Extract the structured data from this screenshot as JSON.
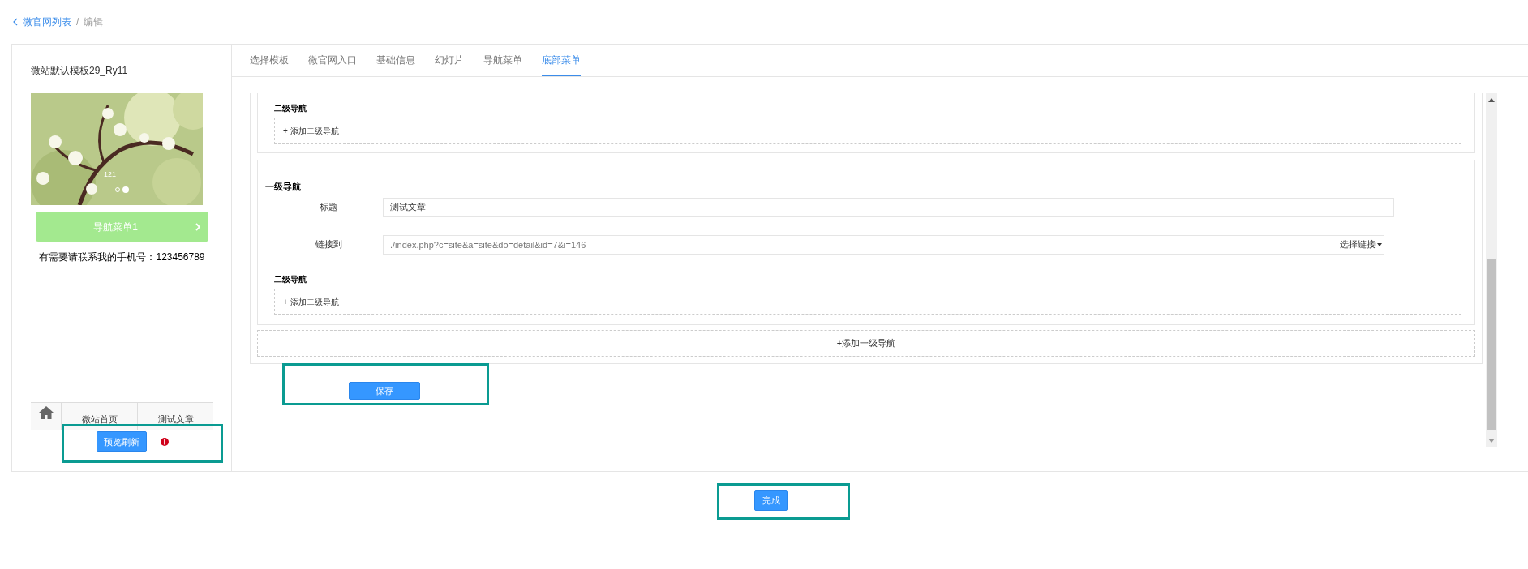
{
  "breadcrumb": {
    "back_link": "微官网列表",
    "separator": "/",
    "current": "编辑"
  },
  "preview": {
    "template_name": "微站默认模板29_Ry11",
    "slideshow": {
      "caption": "121",
      "dots": [
        {
          "selected": false
        },
        {
          "selected": true
        }
      ]
    },
    "nav_button": "导航菜单1",
    "contact_text": "有需要请联系我的手机号：123456789",
    "bottom_nav": [
      {
        "kind": "home"
      },
      {
        "kind": "text",
        "label": "微站首页"
      },
      {
        "kind": "text",
        "label": "测试文章"
      }
    ],
    "refresh_button": "预览刷新"
  },
  "tabs": [
    {
      "label": "选择模板",
      "selected": false
    },
    {
      "label": "微官网入口",
      "selected": false
    },
    {
      "label": "基础信息",
      "selected": false
    },
    {
      "label": "幻灯片",
      "selected": false
    },
    {
      "label": "导航菜单",
      "selected": false
    },
    {
      "label": "底部菜单",
      "selected": true
    }
  ],
  "menu_items": [
    {
      "kind": "cut",
      "sub_heading": "二级导航",
      "add_sub_button": "+ 添加二级导航"
    },
    {
      "kind": "full",
      "heading": "一级导航",
      "title_label": "标题",
      "title_value": "测试文章",
      "link_label": "链接到",
      "link_value": "./index.php?c=site&a=site&do=detail&id=7&i=146",
      "link_picker": "选择链接",
      "sub_heading": "二级导航",
      "add_sub_button": "+ 添加二级导航"
    }
  ],
  "add_first_level_button": "+添加一级导航",
  "save_button": "保存",
  "finish_button": "完成"
}
